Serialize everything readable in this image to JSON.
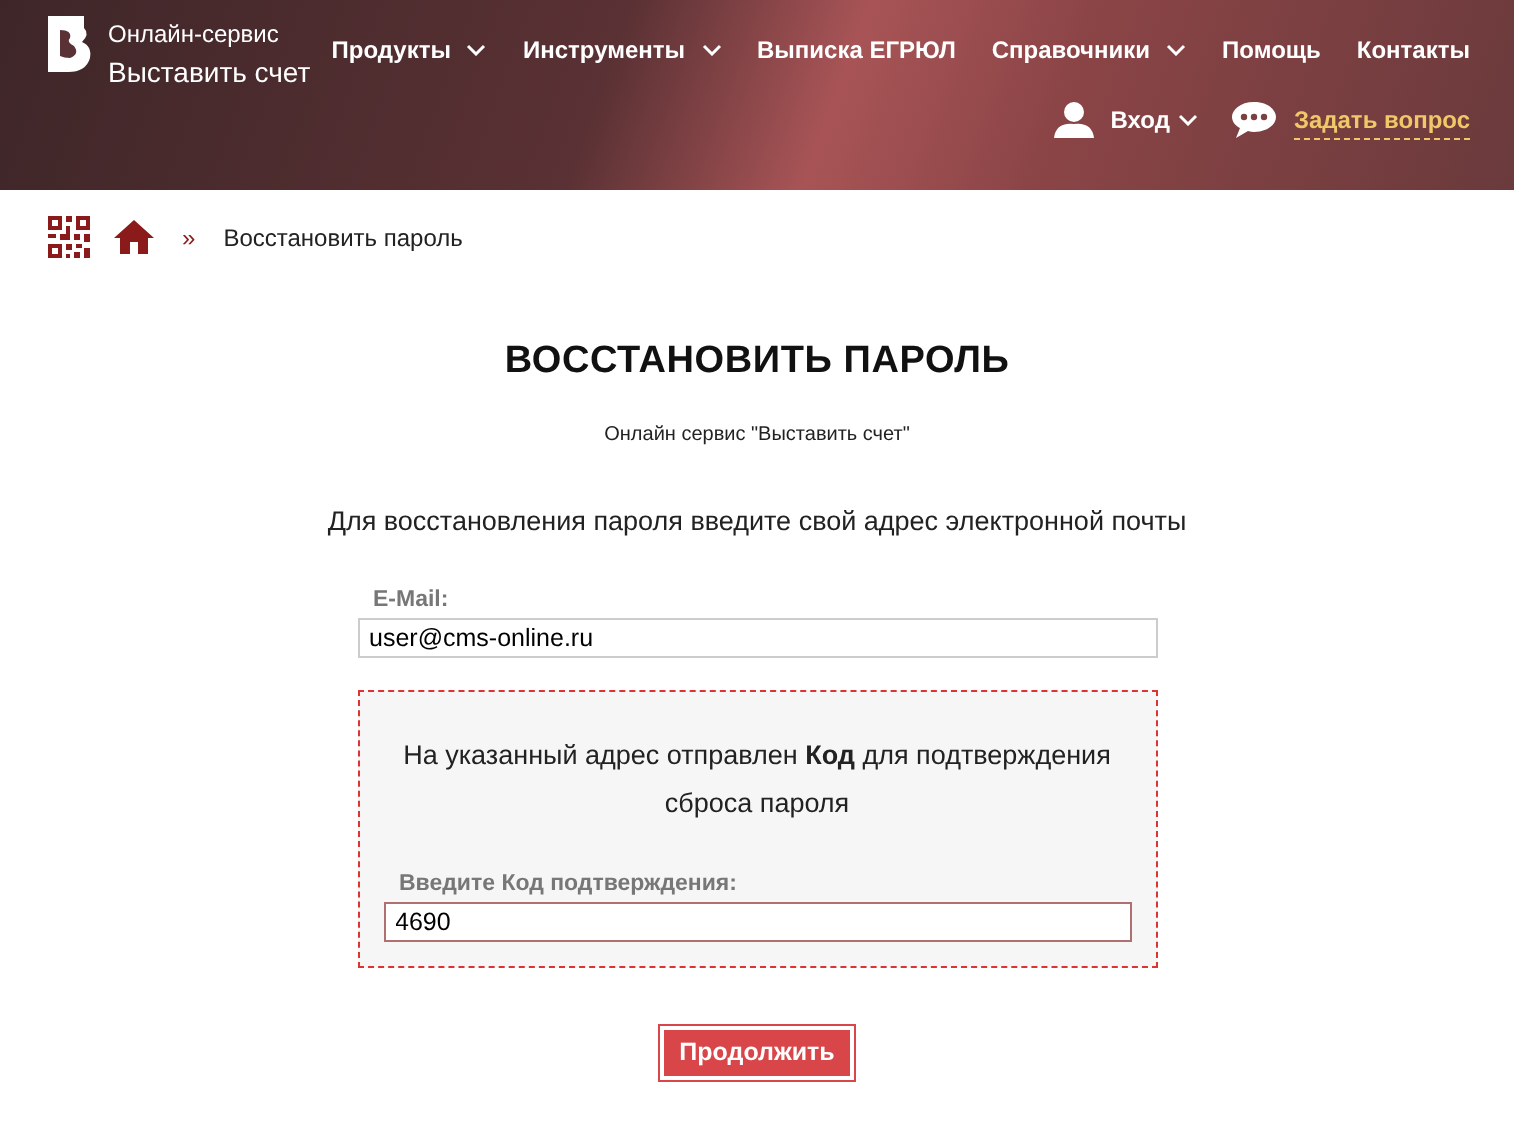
{
  "brand": {
    "line1": "Онлайн-сервис",
    "line2": "Выставить счет"
  },
  "nav": [
    {
      "label": "Продукты",
      "dropdown": true
    },
    {
      "label": "Инструменты",
      "dropdown": true
    },
    {
      "label": "Выписка ЕГРЮЛ",
      "dropdown": false
    },
    {
      "label": "Справочники",
      "dropdown": true
    },
    {
      "label": "Помощь",
      "dropdown": false
    },
    {
      "label": "Контакты",
      "dropdown": false
    }
  ],
  "login": {
    "label": "Вход"
  },
  "ask": {
    "label": "Задать вопрос"
  },
  "breadcrumb": {
    "separator": "»",
    "current": "Восстановить пароль"
  },
  "page": {
    "title": "ВОССТАНОВИТЬ ПАРОЛЬ",
    "subtitle": "Онлайн сервис \"Выставить счет\"",
    "instruction": "Для восстановления пароля введите свой адрес электронной почты"
  },
  "email": {
    "label": "E-Mail:",
    "value": "user@cms-online.ru"
  },
  "code_box": {
    "message": "На указанный адрес отправлен **Код** для подтверждения сброса пароля",
    "label": "Введите Код подтверждения:",
    "value": "4690"
  },
  "submit": {
    "label": "Продолжить"
  }
}
